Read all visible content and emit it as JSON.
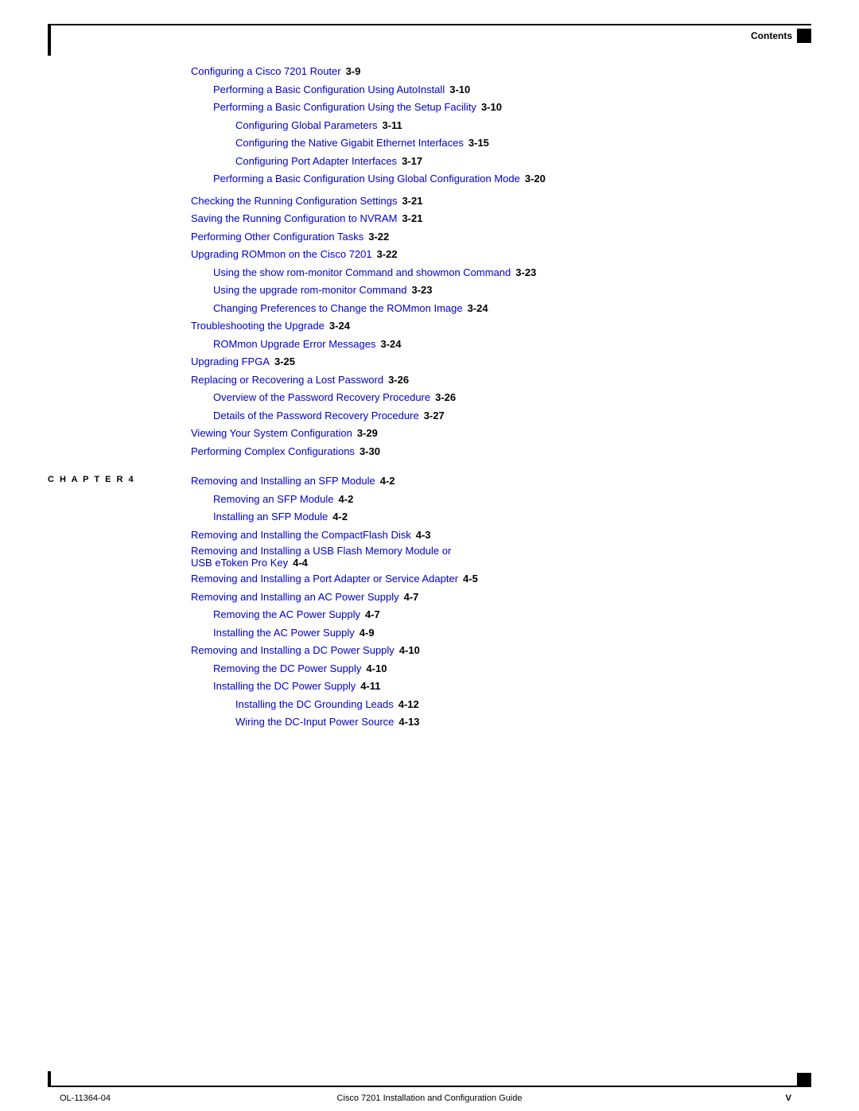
{
  "header": {
    "contents_label": "Contents",
    "left_bar": true
  },
  "footer": {
    "left": "OL-11364-04",
    "right": "V",
    "center": "Cisco 7201 Installation and Configuration Guide"
  },
  "toc": {
    "sections": [
      {
        "indent": 0,
        "text": "Configuring a Cisco 7201 Router",
        "page": "3-9"
      },
      {
        "indent": 1,
        "text": "Performing a Basic Configuration Using AutoInstall",
        "page": "3-10"
      },
      {
        "indent": 1,
        "text": "Performing a Basic Configuration Using the Setup Facility",
        "page": "3-10"
      },
      {
        "indent": 2,
        "text": "Configuring Global Parameters",
        "page": "3-11"
      },
      {
        "indent": 2,
        "text": "Configuring the Native Gigabit Ethernet Interfaces",
        "page": "3-15"
      },
      {
        "indent": 2,
        "text": "Configuring Port Adapter Interfaces",
        "page": "3-17"
      },
      {
        "indent": 1,
        "text": "Performing a Basic Configuration Using Global Configuration Mode",
        "page": "3-20"
      },
      {
        "indent": 0,
        "text": "Checking the Running Configuration Settings",
        "page": "3-21"
      },
      {
        "indent": 0,
        "text": "Saving the Running Configuration to NVRAM",
        "page": "3-21"
      },
      {
        "indent": 0,
        "text": "Performing Other Configuration Tasks",
        "page": "3-22"
      },
      {
        "indent": 0,
        "text": "Upgrading ROMmon on the Cisco 7201",
        "page": "3-22"
      },
      {
        "indent": 1,
        "text": "Using the show rom-monitor Command and showmon Command",
        "page": "3-23"
      },
      {
        "indent": 1,
        "text": "Using the upgrade rom-monitor Command",
        "page": "3-23"
      },
      {
        "indent": 1,
        "text": "Changing Preferences to Change the ROMmon Image",
        "page": "3-24"
      },
      {
        "indent": 0,
        "text": "Troubleshooting the Upgrade",
        "page": "3-24"
      },
      {
        "indent": 1,
        "text": "ROMmon Upgrade Error Messages",
        "page": "3-24"
      },
      {
        "indent": 0,
        "text": "Upgrading FPGA",
        "page": "3-25"
      },
      {
        "indent": 0,
        "text": "Replacing or Recovering a Lost Password",
        "page": "3-26"
      },
      {
        "indent": 1,
        "text": "Overview of the Password Recovery Procedure",
        "page": "3-26"
      },
      {
        "indent": 1,
        "text": "Details of the Password Recovery Procedure",
        "page": "3-27"
      },
      {
        "indent": 0,
        "text": "Viewing Your System Configuration",
        "page": "3-29"
      },
      {
        "indent": 0,
        "text": "Performing Complex Configurations",
        "page": "3-30"
      }
    ],
    "chapter4": {
      "label": "C H A P T E R   4",
      "items": [
        {
          "indent": 0,
          "text": "Removing and Installing an SFP Module",
          "page": "4-2"
        },
        {
          "indent": 1,
          "text": "Removing an SFP Module",
          "page": "4-2"
        },
        {
          "indent": 1,
          "text": "Installing an SFP Module",
          "page": "4-2"
        },
        {
          "indent": 0,
          "text": "Removing and Installing the CompactFlash Disk",
          "page": "4-3"
        },
        {
          "indent": 0,
          "text": "Removing and Installing a USB Flash Memory Module or\nUSB eToken Pro Key",
          "page": "4-4",
          "multiline": true,
          "line1": "Removing and Installing a USB Flash Memory Module or",
          "line2": "USB eToken Pro Key"
        },
        {
          "indent": 0,
          "text": "Removing and Installing a Port Adapter or Service Adapter",
          "page": "4-5"
        },
        {
          "indent": 0,
          "text": "Removing and Installing an AC Power Supply",
          "page": "4-7"
        },
        {
          "indent": 1,
          "text": "Removing the AC Power Supply",
          "page": "4-7"
        },
        {
          "indent": 1,
          "text": "Installing the AC Power Supply",
          "page": "4-9"
        },
        {
          "indent": 0,
          "text": "Removing and Installing a DC Power Supply",
          "page": "4-10"
        },
        {
          "indent": 1,
          "text": "Removing the DC Power Supply",
          "page": "4-10"
        },
        {
          "indent": 1,
          "text": "Installing the DC Power Supply",
          "page": "4-11"
        },
        {
          "indent": 2,
          "text": "Installing the DC Grounding Leads",
          "page": "4-12"
        },
        {
          "indent": 2,
          "text": "Wiring the DC-Input Power Source",
          "page": "4-13"
        }
      ]
    }
  }
}
